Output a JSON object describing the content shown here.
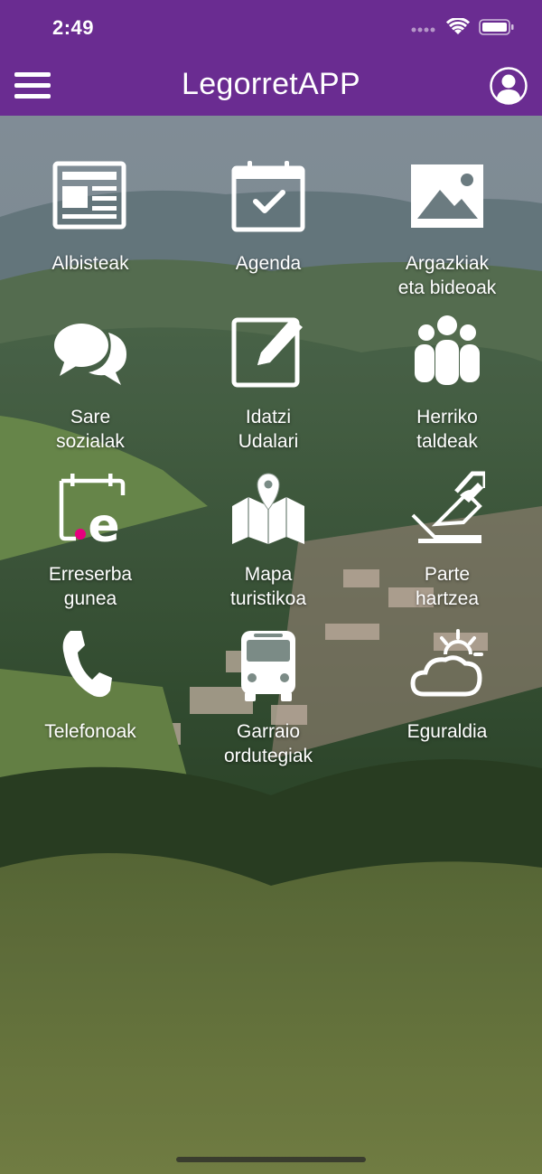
{
  "status_bar": {
    "time": "2:49"
  },
  "header": {
    "title": "LegorretAPP"
  },
  "tiles": [
    {
      "label": "Albisteak",
      "icon": "newspaper-icon"
    },
    {
      "label": "Agenda",
      "icon": "calendar-check-icon"
    },
    {
      "label": "Argazkiak\neta bideoak",
      "icon": "image-icon"
    },
    {
      "label": "Sare\nsozialak",
      "icon": "chat-bubbles-icon"
    },
    {
      "label": "Idatzi\nUdalari",
      "icon": "pencil-note-icon"
    },
    {
      "label": "Herriko\ntaldeak",
      "icon": "group-people-icon"
    },
    {
      "label": "Erreserba\ngunea",
      "icon": "reservation-e-icon"
    },
    {
      "label": "Mapa\nturistikoa",
      "icon": "map-pin-icon"
    },
    {
      "label": "Parte\nhartzea",
      "icon": "vote-ballot-icon"
    },
    {
      "label": "Telefonoak",
      "icon": "phone-icon"
    },
    {
      "label": "Garraio\nordutegiak",
      "icon": "bus-icon"
    },
    {
      "label": "Eguraldia",
      "icon": "weather-sun-cloud-icon"
    }
  ],
  "colors": {
    "header": "#6a2c91",
    "accent_dot": "#e6007e"
  }
}
